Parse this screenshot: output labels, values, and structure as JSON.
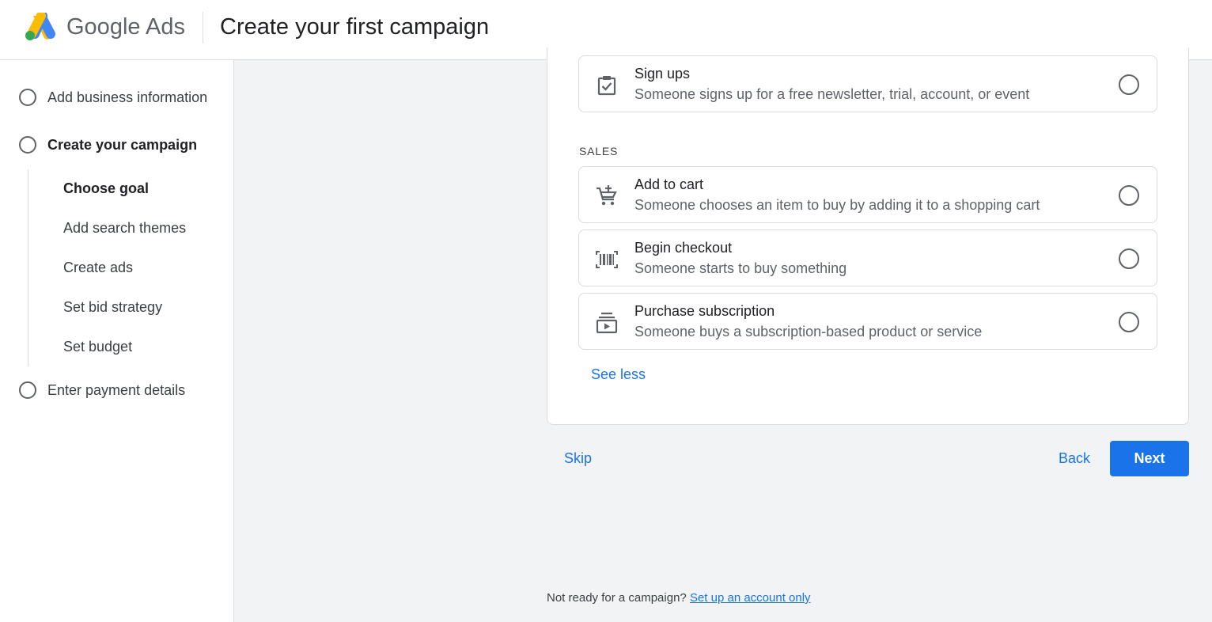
{
  "header": {
    "brand_main": "Google",
    "brand_sub": "Ads",
    "title": "Create your first campaign"
  },
  "sidebar": {
    "steps": [
      {
        "label": "Add business information"
      },
      {
        "label": "Create your campaign"
      },
      {
        "label": "Enter payment details"
      }
    ],
    "substeps": [
      {
        "label": "Choose goal"
      },
      {
        "label": "Add search themes"
      },
      {
        "label": "Create ads"
      },
      {
        "label": "Set bid strategy"
      },
      {
        "label": "Set budget"
      }
    ]
  },
  "goals": {
    "signups": {
      "title": "Sign ups",
      "desc": "Someone signs up for a free newsletter, trial, account, or event",
      "icon": "clipboard-check-icon"
    },
    "sales_label": "SALES",
    "add_to_cart": {
      "title": "Add to cart",
      "desc": "Someone chooses an item to buy by adding it to a shopping cart",
      "icon": "cart-add-icon"
    },
    "begin_checkout": {
      "title": "Begin checkout",
      "desc": "Someone starts to buy something",
      "icon": "barcode-icon"
    },
    "purchase_subscription": {
      "title": "Purchase subscription",
      "desc": "Someone buys a subscription-based product or service",
      "icon": "subscriptions-icon"
    },
    "see_less": "See less"
  },
  "actions": {
    "skip": "Skip",
    "back": "Back",
    "next": "Next"
  },
  "footer": {
    "text": "Not ready for a campaign?",
    "link": "Set up an account only"
  },
  "colors": {
    "accent": "#1a73e8",
    "background": "#f1f3f4"
  }
}
